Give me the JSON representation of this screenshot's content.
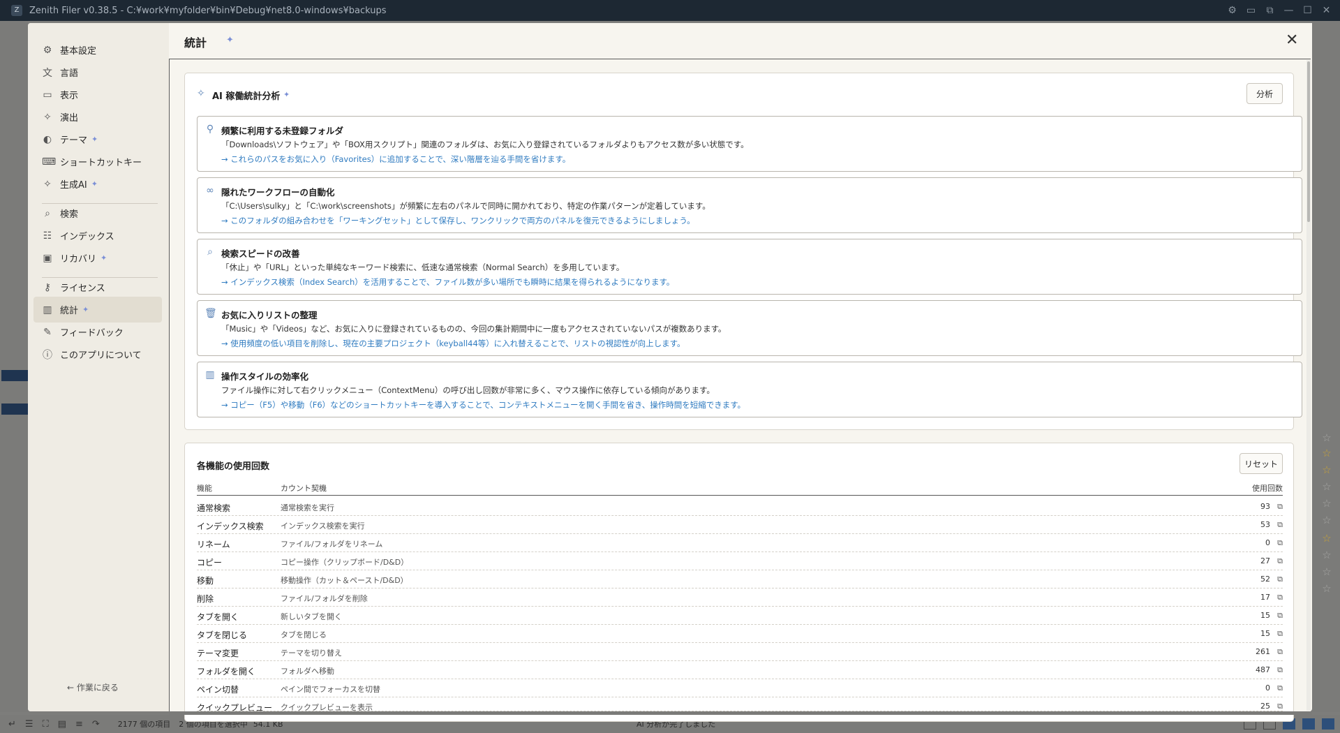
{
  "window": {
    "title": "Zenith Filer v0.38.5 - C:¥work¥myfolder¥bin¥Debug¥net8.0-windows¥backups"
  },
  "status": {
    "count": "2177 個の項目",
    "selection": "2 個の項目を選択中",
    "size": "54.1 KB",
    "message": "AI 分析が完了しました"
  },
  "settings": {
    "title": "統計",
    "back": "作業に戻る",
    "nav": [
      {
        "label": "基本設定"
      },
      {
        "label": "言語"
      },
      {
        "label": "表示"
      },
      {
        "label": "演出"
      },
      {
        "label": "テーマ"
      },
      {
        "label": "ショートカットキー"
      },
      {
        "label": "生成AI"
      },
      {
        "label": "検索"
      },
      {
        "label": "インデックス"
      },
      {
        "label": "リカバリ"
      },
      {
        "label": "ライセンス"
      },
      {
        "label": "統計"
      },
      {
        "label": "フィードバック"
      },
      {
        "label": "このアプリについて"
      }
    ]
  },
  "ai_panel": {
    "title": "AI 稼働統計分析",
    "button": "分析",
    "insights": [
      {
        "title": "頻繁に利用する未登録フォルダ",
        "description": "「Downloads\\ソフトウェア」や「BOX用スクリプト」関連のフォルダは、お気に入り登録されているフォルダよりもアクセス数が多い状態です。",
        "suggestion": "→ これらのパスをお気に入り（Favorites）に追加することで、深い階層を辿る手間を省けます。"
      },
      {
        "title": "隠れたワークフローの自動化",
        "description": "「C:\\Users\\sulky」と「C:\\work\\screenshots」が頻繁に左右のパネルで同時に開かれており、特定の作業パターンが定着しています。",
        "suggestion": "→ このフォルダの組み合わせを「ワーキングセット」として保存し、ワンクリックで両方のパネルを復元できるようにしましょう。"
      },
      {
        "title": "検索スピードの改善",
        "description": "「休止」や「URL」といった単純なキーワード検索に、低速な通常検索（Normal Search）を多用しています。",
        "suggestion": "→ インデックス検索（Index Search）を活用することで、ファイル数が多い場所でも瞬時に結果を得られるようになります。"
      },
      {
        "title": "お気に入りリストの整理",
        "description": "「Music」や「Videos」など、お気に入りに登録されているものの、今回の集計期間中に一度もアクセスされていないパスが複数あります。",
        "suggestion": "→ 使用頻度の低い項目を削除し、現在の主要プロジェクト（keyball44等）に入れ替えることで、リストの視認性が向上します。"
      },
      {
        "title": "操作スタイルの効率化",
        "description": "ファイル操作に対して右クリックメニュー（ContextMenu）の呼び出し回数が非常に多く、マウス操作に依存している傾向があります。",
        "suggestion": "→ コピー（F5）や移動（F6）などのショートカットキーを導入することで、コンテキストメニューを開く手間を省き、操作時間を短縮できます。"
      }
    ]
  },
  "usage_panel": {
    "title": "各機能の使用回数",
    "button": "リセット",
    "headers": {
      "function": "機能",
      "trigger": "カウント契機",
      "count": "使用回数"
    },
    "rows": [
      {
        "function": "通常検索",
        "trigger": "通常検索を実行",
        "count": "93"
      },
      {
        "function": "インデックス検索",
        "trigger": "インデックス検索を実行",
        "count": "53"
      },
      {
        "function": "リネーム",
        "trigger": "ファイル/フォルダをリネーム",
        "count": "0"
      },
      {
        "function": "コピー",
        "trigger": "コピー操作（クリップボード/D&D）",
        "count": "27"
      },
      {
        "function": "移動",
        "trigger": "移動操作（カット＆ペースト/D&D）",
        "count": "52"
      },
      {
        "function": "削除",
        "trigger": "ファイル/フォルダを削除",
        "count": "17"
      },
      {
        "function": "タブを開く",
        "trigger": "新しいタブを開く",
        "count": "15"
      },
      {
        "function": "タブを閉じる",
        "trigger": "タブを閉じる",
        "count": "15"
      },
      {
        "function": "テーマ変更",
        "trigger": "テーマを切り替え",
        "count": "261"
      },
      {
        "function": "フォルダを開く",
        "trigger": "フォルダへ移動",
        "count": "487"
      },
      {
        "function": "ペイン切替",
        "trigger": "ペイン間でフォーカスを切替",
        "count": "0"
      },
      {
        "function": "クイックプレビュー",
        "trigger": "クイックプレビューを表示",
        "count": "25"
      }
    ]
  },
  "colors": {
    "accent": "#2f7bc0",
    "spark": "#7b8fd6",
    "titlebar": "#1d2833"
  }
}
